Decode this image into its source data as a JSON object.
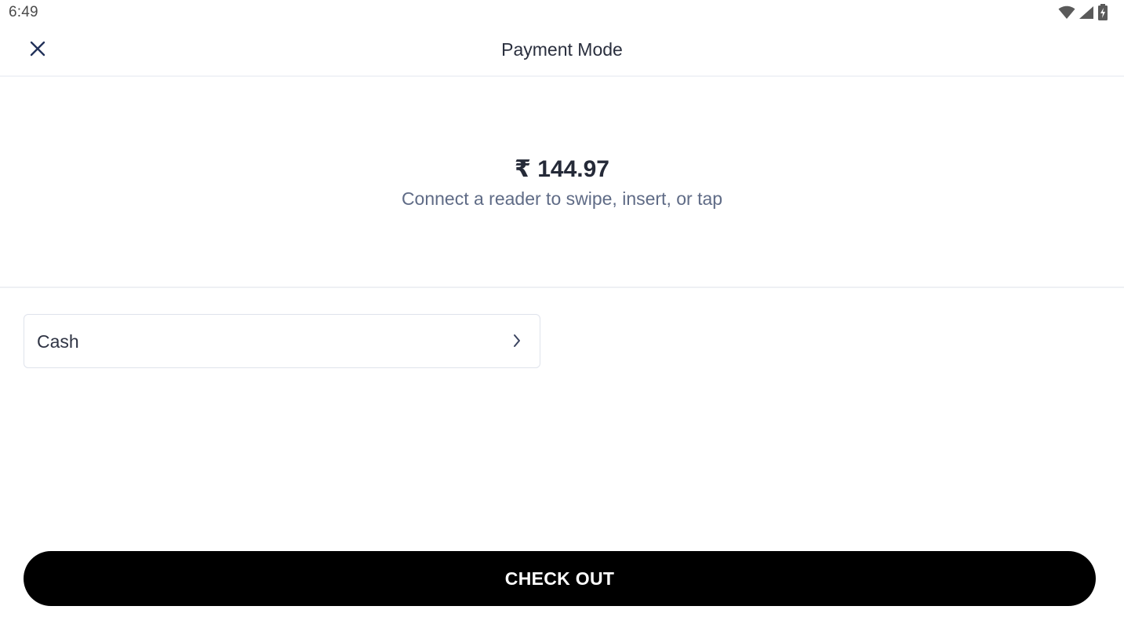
{
  "status_bar": {
    "time": "6:49",
    "icons": [
      "wifi-icon",
      "cellular-signal-icon",
      "battery-charging-icon"
    ]
  },
  "header": {
    "title": "Payment Mode",
    "close_icon": "close-icon"
  },
  "payment": {
    "amount": "₹ 144.97",
    "hint": "Connect a reader to swipe, insert, or tap"
  },
  "options": [
    {
      "label": "Cash",
      "icon": "chevron-right-icon"
    }
  ],
  "footer": {
    "checkout_label": "CHECK OUT"
  },
  "colors": {
    "button_bg": "#000000",
    "button_text": "#ffffff",
    "hint_text": "#5f6b86",
    "divider": "#eef0f4",
    "option_border": "#dfe3ec"
  }
}
